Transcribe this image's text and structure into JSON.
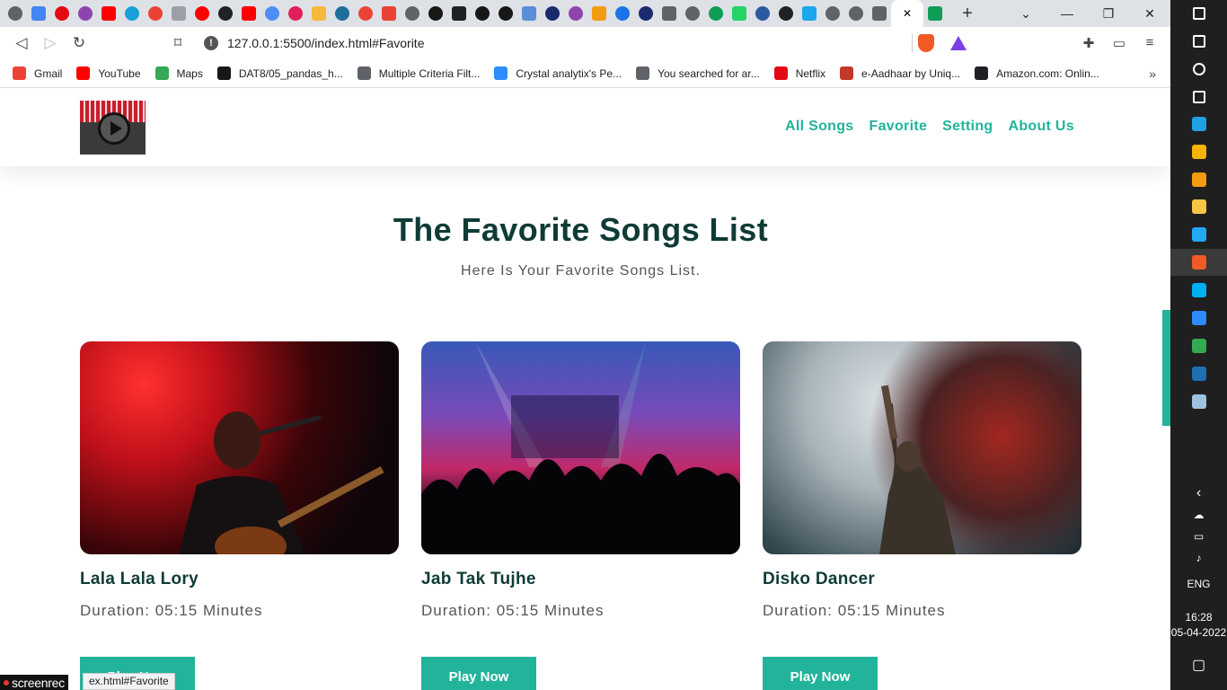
{
  "browser": {
    "tabs": [
      {
        "icon": "globe-icon",
        "color": "#5f6368"
      },
      {
        "icon": "google-icon",
        "color": "#4285f4"
      },
      {
        "icon": "netflix-icon",
        "color": "#e50914"
      },
      {
        "icon": "ufo-icon",
        "color": "#8e44ad"
      },
      {
        "icon": "youtube-icon",
        "color": "#ff0000"
      },
      {
        "icon": "n-icon",
        "color": "#1aa0d8"
      },
      {
        "icon": "gmail-icon",
        "color": "#ea4335"
      },
      {
        "icon": "drive-icon",
        "color": "#9aa0a6"
      },
      {
        "icon": "youtube-icon",
        "color": "#ff0000"
      },
      {
        "icon": "letter-icon",
        "color": "#202124"
      },
      {
        "icon": "youtube-icon",
        "color": "#ff0000"
      },
      {
        "icon": "target-icon",
        "color": "#4e8ff7"
      },
      {
        "icon": "slack-icon",
        "color": "#e01e5a"
      },
      {
        "icon": "hand-icon",
        "color": "#f6b93b"
      },
      {
        "icon": "e-icon",
        "color": "#1d6f9c"
      },
      {
        "icon": "gmail-icon",
        "color": "#ea4335"
      },
      {
        "icon": "gmail-icon",
        "color": "#ea4335"
      },
      {
        "icon": "globe-icon",
        "color": "#5f6368"
      },
      {
        "icon": "github-icon",
        "color": "#181717"
      },
      {
        "icon": "cube-icon",
        "color": "#202124"
      },
      {
        "icon": "github-icon",
        "color": "#181717"
      },
      {
        "icon": "github-icon",
        "color": "#181717"
      },
      {
        "icon": "cloud-icon",
        "color": "#5a8fd8"
      },
      {
        "icon": "square-icon",
        "color": "#1b2a6b"
      },
      {
        "icon": "ufo-icon",
        "color": "#8e44ad"
      },
      {
        "icon": "bookmark-icon",
        "color": "#f39c12"
      },
      {
        "icon": "play-icon",
        "color": "#1a73e8"
      },
      {
        "icon": "square-icon",
        "color": "#1b2a6b"
      },
      {
        "icon": "globe-icon",
        "color": "#5f6368"
      },
      {
        "icon": "globe-icon",
        "color": "#5f6368"
      },
      {
        "icon": "w-icon",
        "color": "#0f9d58"
      },
      {
        "icon": "whatsapp-icon",
        "color": "#25d366"
      },
      {
        "icon": "s-icon",
        "color": "#2c5aa0"
      },
      {
        "icon": "codepen-icon",
        "color": "#202124"
      },
      {
        "icon": "cwh-icon",
        "color": "#1aa7ec"
      },
      {
        "icon": "globe-icon",
        "color": "#5f6368"
      },
      {
        "icon": "globe-icon",
        "color": "#5f6368"
      },
      {
        "icon": "globe-icon",
        "color": "#5f6368"
      }
    ],
    "active_tab_close": "✕",
    "trailing_tab": {
      "icon": "w-icon",
      "color": "#0f9d58"
    },
    "new_tab": "+",
    "url": "127.0.0.1:5500/index.html#Favorite",
    "bookmarks": [
      {
        "label": "Gmail",
        "icon": "gmail-icon",
        "color": "#ea4335"
      },
      {
        "label": "YouTube",
        "icon": "youtube-icon",
        "color": "#ff0000"
      },
      {
        "label": "Maps",
        "icon": "maps-icon",
        "color": "#34a853"
      },
      {
        "label": "DAT8/05_pandas_h...",
        "icon": "github-icon",
        "color": "#181717"
      },
      {
        "label": "Multiple Criteria Filt...",
        "icon": "globe-icon",
        "color": "#5f6368"
      },
      {
        "label": "Crystal analytix's Pe...",
        "icon": "zoom-icon",
        "color": "#2d8cff"
      },
      {
        "label": "You searched for ar...",
        "icon": "globe-icon",
        "color": "#5f6368"
      },
      {
        "label": "Netflix",
        "icon": "netflix-icon",
        "color": "#e50914"
      },
      {
        "label": "e-Aadhaar by Uniq...",
        "icon": "aadhaar-icon",
        "color": "#c0392b"
      },
      {
        "label": "Amazon.com: Onlin...",
        "icon": "amazon-icon",
        "color": "#202124"
      }
    ]
  },
  "site": {
    "nav": [
      "All Songs",
      "Favorite",
      "Setting",
      "About Us"
    ],
    "title": "The Favorite Songs List",
    "subtitle": "Here Is Your Favorite Songs List.",
    "accent": "#22b39b",
    "cards": [
      {
        "title": "Lala Lala Lory",
        "duration": "Duration: 05:15 Minutes",
        "button": "Play Now"
      },
      {
        "title": "Jab Tak Tujhe",
        "duration": "Duration: 05:15 Minutes",
        "button": "Play Now"
      },
      {
        "title": "Disko Dancer",
        "duration": "Duration: 05:15 Minutes",
        "button": "Play Now"
      }
    ]
  },
  "status_bar": "ex.html#Favorite",
  "watermark": "screenrec",
  "taskbar": {
    "apps": [
      {
        "icon": "windows-icon",
        "color": "#ffffff"
      },
      {
        "icon": "search-icon",
        "color": "#ffffff"
      },
      {
        "icon": "cortana-icon",
        "color": "#ffffff"
      },
      {
        "icon": "task-view-icon",
        "color": "#ffffff"
      },
      {
        "icon": "edge-icon",
        "color": "#1fa0e3"
      },
      {
        "icon": "chrome-icon",
        "color": "#f4b400"
      },
      {
        "icon": "vlc-icon",
        "color": "#f39c12"
      },
      {
        "icon": "folder-icon",
        "color": "#f6c744"
      },
      {
        "icon": "vscode-icon",
        "color": "#23a9f2"
      },
      {
        "icon": "brave-icon",
        "color": "#f15a24"
      },
      {
        "icon": "skype-icon",
        "color": "#00aff0"
      },
      {
        "icon": "zoom-icon",
        "color": "#2d8cff"
      },
      {
        "icon": "chrome-icon",
        "color": "#34a853"
      },
      {
        "icon": "photos-icon",
        "color": "#1f6fb2"
      },
      {
        "icon": "notepad-icon",
        "color": "#9fc3de"
      }
    ],
    "language": "ENG",
    "time": "16:28",
    "date": "05-04-2022"
  }
}
